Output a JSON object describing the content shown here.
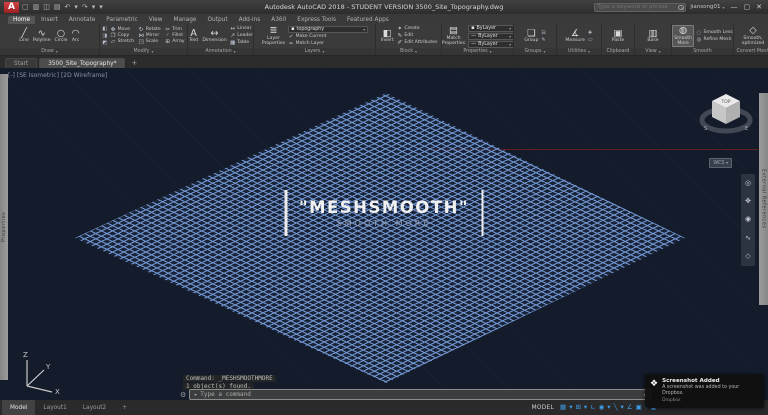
{
  "icons": {
    "logo": "A",
    "caret": "▾",
    "caret_up": "▴",
    "prompt": "▸",
    "wrench": "⚙",
    "dropbox": "❖",
    "min": "—",
    "max": "▢",
    "close": "✕"
  },
  "title_bar": {
    "qat": [
      "▢",
      "▥",
      "◫",
      "▤",
      "↶",
      "▾",
      "↷",
      "▾",
      "▾"
    ],
    "app_title": "Autodesk AutoCAD 2018 - STUDENT VERSION   3500_Site_Topography.dwg",
    "search_placeholder": "Type a keyword or phrase",
    "user_name": "jiansong01"
  },
  "ribbon": {
    "tabs": [
      "Home",
      "Insert",
      "Annotate",
      "Parametric",
      "View",
      "Manage",
      "Output",
      "Add-ins",
      "A360",
      "Express Tools",
      "Featured Apps"
    ],
    "panels": {
      "draw": {
        "label": "Draw",
        "tools": [
          {
            "ic": "╱",
            "lb": "Line"
          },
          {
            "ic": "∿",
            "lb": "Polyline"
          },
          {
            "ic": "○",
            "lb": "Circle"
          },
          {
            "ic": "◠",
            "lb": "Arc"
          }
        ]
      },
      "modify": {
        "label": "Modify",
        "flyouts": [
          "◧",
          "◨",
          "◩"
        ],
        "tools": [
          {
            "ic": "✥",
            "lb": "Move"
          },
          {
            "ic": "↻",
            "lb": "Rotate"
          },
          {
            "ic": "✂",
            "lb": "Trim"
          },
          {
            "ic": "❐",
            "lb": "Copy"
          },
          {
            "ic": "⋈",
            "lb": "Mirror"
          },
          {
            "ic": "◜",
            "lb": "Fillet"
          },
          {
            "ic": "▱",
            "lb": "Stretch"
          },
          {
            "ic": "◳",
            "lb": "Scale"
          },
          {
            "ic": "⊞",
            "lb": "Array"
          }
        ]
      },
      "annotation": {
        "label": "Annotation",
        "big": [
          {
            "ic": "A",
            "lb": "Text"
          },
          {
            "ic": "↔",
            "lb": "Dimension"
          }
        ],
        "rows": [
          {
            "ic": "↔",
            "lb": "Linear"
          },
          {
            "ic": "↗",
            "lb": "Leader"
          },
          {
            "ic": "▦",
            "lb": "Table"
          }
        ]
      },
      "layers": {
        "label": "Layers",
        "big": {
          "ic": "≣",
          "lb": "Layer\nProperties"
        },
        "layer_swatch": "▪",
        "layer_value": "topography",
        "rows": [
          {
            "ic": "✓",
            "lb": "Make Current"
          },
          {
            "ic": "≈",
            "lb": "Match Layer"
          }
        ]
      },
      "block": {
        "label": "Block",
        "big": {
          "ic": "◧",
          "lb": "Insert"
        },
        "rows": [
          {
            "ic": "✦",
            "lb": "Create"
          },
          {
            "ic": "✎",
            "lb": "Edit"
          },
          {
            "ic": "✐",
            "lb": "Edit Attributes"
          }
        ]
      },
      "properties": {
        "label": "Properties",
        "big": {
          "ic": "▤",
          "lb": "Match\nProperties"
        },
        "dropdowns": [
          {
            "sw": "▪",
            "label": "ByLayer"
          },
          {
            "sw": "—",
            "label": "ByLayer"
          },
          {
            "sw": "—",
            "label": "ByLayer"
          }
        ]
      },
      "groups": {
        "label": "Groups",
        "big": {
          "ic": "❏",
          "lb": "Group"
        },
        "smalls": [
          "⊟",
          "✎"
        ]
      },
      "utilities": {
        "label": "Utilities",
        "big": {
          "ic": "∡",
          "lb": "Measure"
        },
        "smalls": [
          "✚",
          "▭"
        ]
      },
      "clipboard": {
        "label": "Clipboard",
        "big": {
          "ic": "▣",
          "lb": "Paste"
        },
        "smalls": [
          "✂",
          "❐"
        ]
      },
      "view": {
        "label": "View",
        "big": {
          "ic": "▥",
          "lb": "Base"
        }
      },
      "smooth": {
        "label": "Smooth",
        "big": {
          "ic": "◍",
          "lb": "Smooth\nMore"
        },
        "rows": [
          {
            "ic": "◌",
            "lb": "Smooth Less"
          },
          {
            "ic": "◎",
            "lb": "Refine Mesh"
          }
        ]
      },
      "convert": {
        "label": "Convert Mesh",
        "big": {
          "ic": "◇",
          "lb": "Smooth,\noptimized"
        }
      }
    }
  },
  "file_tabs": {
    "start": "Start",
    "active": "3500_Site_Topography*",
    "add": "+"
  },
  "canvas": {
    "viewport_controls": [
      "[-]",
      "[SE Isometric]",
      "[2D Wireframe]"
    ],
    "left_palette": "Properties",
    "right_palette": "External References",
    "viewcube": {
      "top": "TOP",
      "south": "S",
      "east": "E",
      "wcs": "WCS"
    },
    "navbar_icons": [
      "◎",
      "✥",
      "◉",
      "∿",
      "◇"
    ],
    "overlay": {
      "title": "\"MESHSMOOTH\"",
      "subtitle": "SMOOTH MORE"
    },
    "ucs": {
      "x": "X",
      "y": "Y",
      "z": "Z"
    },
    "command": {
      "history": [
        "Command: _MESHSMOOTHMORE",
        "1 object(s) found."
      ],
      "placeholder": "Type a command"
    }
  },
  "status_bar": {
    "layout_tabs": [
      "Model",
      "Layout1",
      "Layout2",
      "+"
    ],
    "model_label": "MODEL",
    "icons": [
      "▦",
      "▾",
      "⊞",
      "▾",
      "∟",
      "◉",
      "▾",
      "╲",
      "▾",
      "∠",
      "▣",
      "▾",
      "▲"
    ]
  },
  "notification": {
    "title": "Screenshot Added",
    "body": "A screenshot was added to your Dropbox.",
    "source": "Dropbox"
  }
}
